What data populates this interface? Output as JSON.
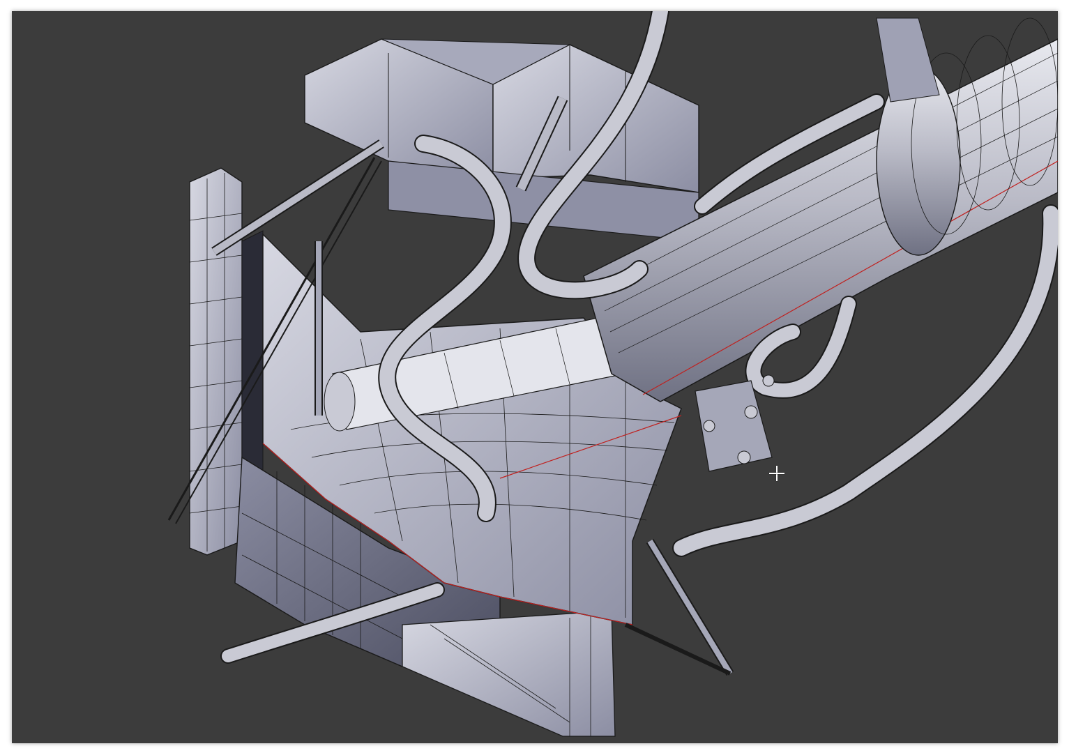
{
  "viewport": {
    "mode": "solid-wireframe",
    "background_color": "#3c3c3c",
    "mesh_color": "#b7b9c9",
    "wire_color": "#1a1a1a",
    "seam_color": "#c0201e"
  },
  "cursor": {
    "icon": "crosshair-cursor-icon"
  }
}
